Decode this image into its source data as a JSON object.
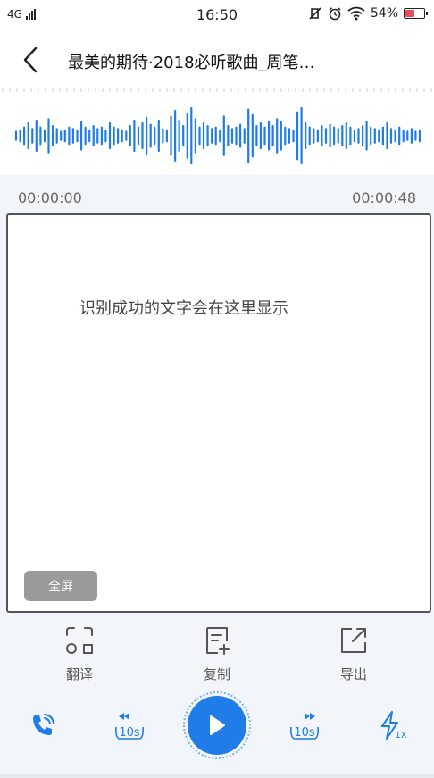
{
  "status_bar": {
    "network": "4G",
    "time": "16:50",
    "battery_percent": "54%",
    "battery_level": 0.54,
    "battery_color": "#e84b5a"
  },
  "header": {
    "title": "最美的期待·2018必听歌曲_周笔…"
  },
  "waveform": {
    "color": "#1f7ce8",
    "levels": [
      0.15,
      0.2,
      0.3,
      0.45,
      0.25,
      0.55,
      0.3,
      0.2,
      0.6,
      0.35,
      0.25,
      0.15,
      0.2,
      0.3,
      0.25,
      0.2,
      0.5,
      0.3,
      0.2,
      0.35,
      0.25,
      0.3,
      0.2,
      0.45,
      0.3,
      0.25,
      0.2,
      0.15,
      0.35,
      0.55,
      0.3,
      0.45,
      0.65,
      0.4,
      0.3,
      0.55,
      0.25,
      0.2,
      0.7,
      0.9,
      0.55,
      0.35,
      0.8,
      1.0,
      0.6,
      0.3,
      0.45,
      0.35,
      0.25,
      0.3,
      0.2,
      0.7,
      0.35,
      0.25,
      0.3,
      0.4,
      0.25,
      0.95,
      0.75,
      0.35,
      0.45,
      0.3,
      0.5,
      0.35,
      0.6,
      0.5,
      0.3,
      0.25,
      0.2,
      0.85,
      1.0,
      0.45,
      0.3,
      0.25,
      0.2,
      0.35,
      0.25,
      0.4,
      0.3,
      0.25,
      0.35,
      0.45,
      0.3,
      0.2,
      0.25,
      0.35,
      0.5,
      0.3,
      0.25,
      0.2,
      0.3,
      0.45,
      0.25,
      0.2,
      0.3,
      0.2,
      0.15,
      0.25,
      0.15,
      0.2
    ]
  },
  "timeline": {
    "current": "00:00:00",
    "total": "00:00:48"
  },
  "panel": {
    "placeholder": "识别成功的文字会在这里显示",
    "fullscreen_label": "全屏"
  },
  "actions": {
    "translate": "翻译",
    "copy": "复制",
    "export": "导出"
  },
  "player": {
    "rewind_label": "10s",
    "forward_label": "10s",
    "speed_label": "1X",
    "accent": "#1f7ce8"
  }
}
